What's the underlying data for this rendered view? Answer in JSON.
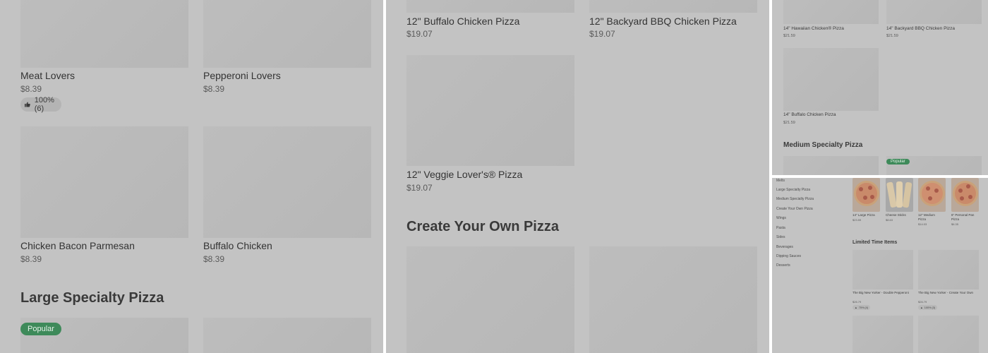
{
  "panel_a": {
    "row1": [
      {
        "name": "Meat Lovers",
        "price": "$8.39",
        "rating": "100% (6)"
      },
      {
        "name": "Pepperoni Lovers",
        "price": "$8.39"
      }
    ],
    "row2": [
      {
        "name": "Chicken Bacon Parmesan",
        "price": "$8.39"
      },
      {
        "name": "Buffalo Chicken",
        "price": "$8.39"
      }
    ],
    "section_title": "Large Specialty Pizza",
    "badge": "Popular"
  },
  "panel_b": {
    "row1": [
      {
        "name": "12\" Buffalo Chicken Pizza",
        "price": "$19.07"
      },
      {
        "name": "12\" Backyard BBQ Chicken Pizza",
        "price": "$19.07"
      }
    ],
    "row2": [
      {
        "name": "12\" Veggie Lover's® Pizza",
        "price": "$19.07"
      }
    ],
    "section_title": "Create Your Own Pizza"
  },
  "panel_c": {
    "row1": [
      {
        "name": "14\" Hawaiian Chicken® Pizza",
        "price": "$21.59"
      },
      {
        "name": "14\" Backyard BBQ Chicken Pizza",
        "price": "$21.59"
      }
    ],
    "row2": [
      {
        "name": "14\" Buffalo Chicken Pizza",
        "price": "$21.59"
      }
    ],
    "section_title": "Medium Specialty Pizza",
    "badge": "Popular"
  },
  "panel_d": {
    "sidebar": [
      "Melts",
      "Large Specialty Pizza",
      "Medium Specialty Pizza",
      "Create Your Own Pizza",
      "Wings",
      "Pasta",
      "Sides",
      "Beverages",
      "Dipping Sauces",
      "Desserts"
    ],
    "featured": [
      {
        "name": "14\" Large Pizza",
        "price": "$23.59"
      },
      {
        "name": "Cheese Sticks",
        "price": "$8.63"
      },
      {
        "name": "12\" Medium Pizza",
        "price": "$14.03"
      },
      {
        "name": "6\" Personal Pan Pizza",
        "price": "$6.35"
      }
    ],
    "section_title": "Limited Time Items",
    "limited": [
      {
        "name": "The Big New Yorker - Double Pepperoni",
        "price": "$26.79",
        "rating": "75% (4)"
      },
      {
        "name": "The Big New Yorker - Create Your Own",
        "price": "$26.79",
        "rating": "100% (3)"
      }
    ]
  },
  "colors": {
    "overlay": "#c3c3c3",
    "popular_badge": "#3e8a5a",
    "gutter": "#ffffff"
  }
}
